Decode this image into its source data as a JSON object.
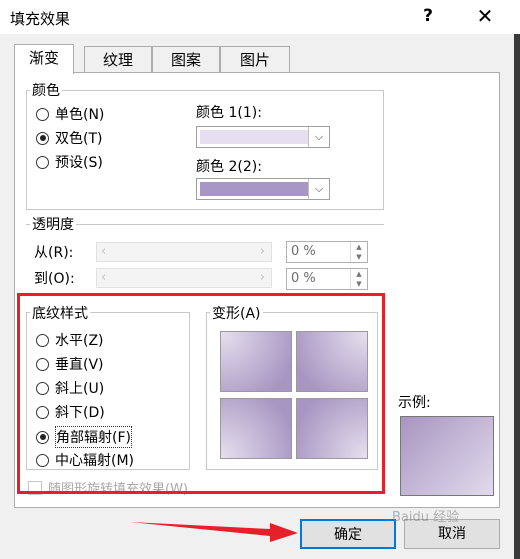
{
  "window": {
    "title": "填充效果",
    "help": "?",
    "close": "✕"
  },
  "tabs": [
    {
      "label": "渐变",
      "active": true
    },
    {
      "label": "纹理",
      "active": false
    },
    {
      "label": "图案",
      "active": false
    },
    {
      "label": "图片",
      "active": false
    }
  ],
  "colors_group": {
    "label": "颜色",
    "options": [
      {
        "label": "单色(N)",
        "checked": false
      },
      {
        "label": "双色(T)",
        "checked": true
      },
      {
        "label": "预设(S)",
        "checked": false
      }
    ],
    "color1": {
      "label": "颜色 1(1):",
      "swatch": "#e6dff0"
    },
    "color2": {
      "label": "颜色 2(2):",
      "swatch": "#a897c6"
    }
  },
  "transparency_group": {
    "label": "透明度",
    "from": {
      "label": "从(R):",
      "value": "0 %"
    },
    "to": {
      "label": "到(O):",
      "value": "0 %"
    }
  },
  "shading_group": {
    "label": "底纹样式",
    "options": [
      {
        "label": "水平(Z)",
        "checked": false
      },
      {
        "label": "垂直(V)",
        "checked": false
      },
      {
        "label": "斜上(U)",
        "checked": false
      },
      {
        "label": "斜下(D)",
        "checked": false
      },
      {
        "label": "角部辐射(F)",
        "checked": true
      },
      {
        "label": "中心辐射(M)",
        "checked": false
      }
    ]
  },
  "variants_group": {
    "label": "变形(A)"
  },
  "rotate_checkbox": {
    "label": "随图形旋转填充效果(W)",
    "checked": false,
    "enabled": false
  },
  "sample": {
    "label": "示例:",
    "color_light": "#e2dbec",
    "color_dark": "#a795c0"
  },
  "buttons": {
    "ok": "确定",
    "cancel": "取消"
  },
  "watermark": "Baidu 经验",
  "accent": {
    "highlight": "#e5202a",
    "focus": "#0078d7"
  }
}
